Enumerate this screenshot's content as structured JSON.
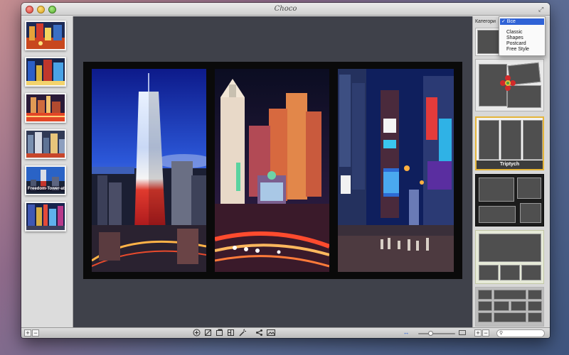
{
  "window": {
    "title": "Choco"
  },
  "sidebar": {
    "thumbnails": [
      {
        "caption": ""
      },
      {
        "caption": ""
      },
      {
        "caption": ""
      },
      {
        "caption": ""
      },
      {
        "caption": "Freedom-Tower-at-..."
      },
      {
        "caption": ""
      }
    ]
  },
  "right_panel": {
    "category_label": "Категори",
    "dropdown": {
      "selected": "✓ Все",
      "options": [
        "Classic",
        "Shapes",
        "Postcard",
        "Free Style"
      ]
    },
    "layouts": [
      {
        "name": "",
        "selected": false
      },
      {
        "name": "",
        "selected": false
      },
      {
        "name": "Triptych",
        "selected": true
      },
      {
        "name": "",
        "selected": false
      },
      {
        "name": "",
        "selected": false
      },
      {
        "name": "",
        "selected": false
      }
    ]
  },
  "bottombar": {
    "left_add": "+",
    "left_remove": "−",
    "right_add": "+",
    "right_remove": "−",
    "search_placeholder": "",
    "zoom_level": 0.3
  },
  "icons": {
    "add_circle": "add-circle-icon",
    "crop": "crop-icon",
    "page": "page-icon",
    "layout": "layout-icon",
    "magic": "magic-wand-icon",
    "share": "share-icon",
    "photo": "photo-icon"
  },
  "colors": {
    "canvas_bg": "#3f414a",
    "selection": "#e5b53a",
    "dropdown_highlight": "#2f62d6"
  }
}
